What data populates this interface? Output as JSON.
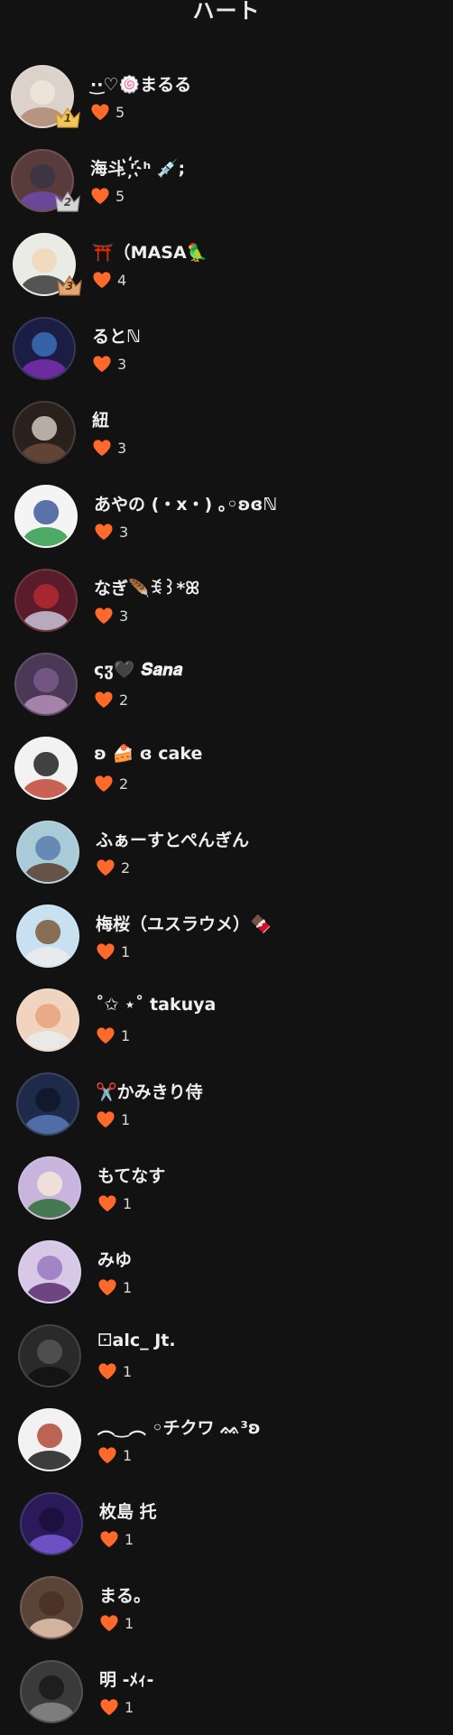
{
  "header": {
    "title": "ハート"
  },
  "colors": {
    "background": "#121212",
    "heart": "#ff6a2b",
    "text": "#efefef"
  },
  "users": [
    {
      "name": "·͜·♡🍥まるる",
      "hearts": "5",
      "rank": "1",
      "avatar": {
        "bg": "#dcd2cb",
        "a": "#b08a73",
        "b": "#f1e6dc"
      }
    },
    {
      "name": "海斗 ʳ҉ʰ 💉;",
      "hearts": "5",
      "rank": "2",
      "avatar": {
        "bg": "#5a3b3b",
        "a": "#6d4aa8",
        "b": "#3a3546"
      }
    },
    {
      "name": "⛩️（MASA🦜",
      "hearts": "4",
      "rank": "3",
      "avatar": {
        "bg": "#e8ece4",
        "a": "#3a3a3a",
        "b": "#f3d7b8"
      }
    },
    {
      "name": "るとℕ",
      "hearts": "3",
      "avatar": {
        "bg": "#1b1d44",
        "a": "#7a2fb0",
        "b": "#3b6fb8"
      }
    },
    {
      "name": "紐",
      "hearts": "3",
      "avatar": {
        "bg": "#2b211c",
        "a": "#6b4a3a",
        "b": "#cfc6bc"
      }
    },
    {
      "name": "あやの (・x・) ｡◦ʚɞℕ",
      "hearts": "3",
      "avatar": {
        "bg": "#f4f4f4",
        "a": "#2f9c4b",
        "b": "#3f5a9a"
      }
    },
    {
      "name": "なぎ🪶ꉂ꒱*ꕤ",
      "hearts": "3",
      "avatar": {
        "bg": "#5a1c2a",
        "a": "#c9c3d8",
        "b": "#b32a33"
      }
    },
    {
      "name": "ςჳ🖤 𝑺𝒂𝒏𝒂",
      "hearts": "2",
      "avatar": {
        "bg": "#4a3856",
        "a": "#b48fb8",
        "b": "#7a5a8a"
      }
    },
    {
      "name": "ʚ 🍰 ɞ cake",
      "hearts": "2",
      "avatar": {
        "bg": "#f2f2f2",
        "a": "#c2483a",
        "b": "#222222"
      }
    },
    {
      "name": "ふぁーすとぺんぎん",
      "hearts": "2",
      "avatar": {
        "bg": "#a9cbd8",
        "a": "#5a3d2e",
        "b": "#5b7fae"
      }
    },
    {
      "name": "梅桜（ユスラウメ）🍫",
      "hearts": "1",
      "avatar": {
        "bg": "#c8e0ef",
        "a": "#ececec",
        "b": "#7a5a3a"
      }
    },
    {
      "name": "˚✩ ⋆˚ takuya",
      "hearts": "1",
      "avatar": {
        "bg": "#f0d4c0",
        "a": "#e8ecef",
        "b": "#e8a27a"
      }
    },
    {
      "name": "✂️かみきり侍",
      "hearts": "1",
      "avatar": {
        "bg": "#1d2a4a",
        "a": "#5a79b8",
        "b": "#0f1628"
      }
    },
    {
      "name": "もてなす",
      "hearts": "1",
      "avatar": {
        "bg": "#c8b4dc",
        "a": "#2e6e3a",
        "b": "#f4e7d8"
      }
    },
    {
      "name": "みゆ",
      "hearts": "1",
      "avatar": {
        "bg": "#d8c8e8",
        "a": "#5a2f6e",
        "b": "#9a78c0"
      }
    },
    {
      "name": "⚀alc_ Jt.",
      "hearts": "1",
      "avatar": {
        "bg": "#2a2a2a",
        "a": "#111111",
        "b": "#555555"
      }
    },
    {
      "name": "︵‿︵ ◦チクワ ᨐ³ʚ",
      "hearts": "1",
      "avatar": {
        "bg": "#f2f2f2",
        "a": "#1d1d1d",
        "b": "#b34a3a"
      }
    },
    {
      "name": "枚島 托",
      "hearts": "1",
      "avatar": {
        "bg": "#2a1a5a",
        "a": "#7a5ad8",
        "b": "#1a0f3a"
      }
    },
    {
      "name": "まる。",
      "hearts": "1",
      "avatar": {
        "bg": "#5a4438",
        "a": "#e8c8b0",
        "b": "#4a2e22"
      }
    },
    {
      "name": "明 -ﾒｨ-",
      "hearts": "1",
      "avatar": {
        "bg": "#3a3a3a",
        "a": "#8a8a8a",
        "b": "#1a1a1a"
      }
    }
  ]
}
